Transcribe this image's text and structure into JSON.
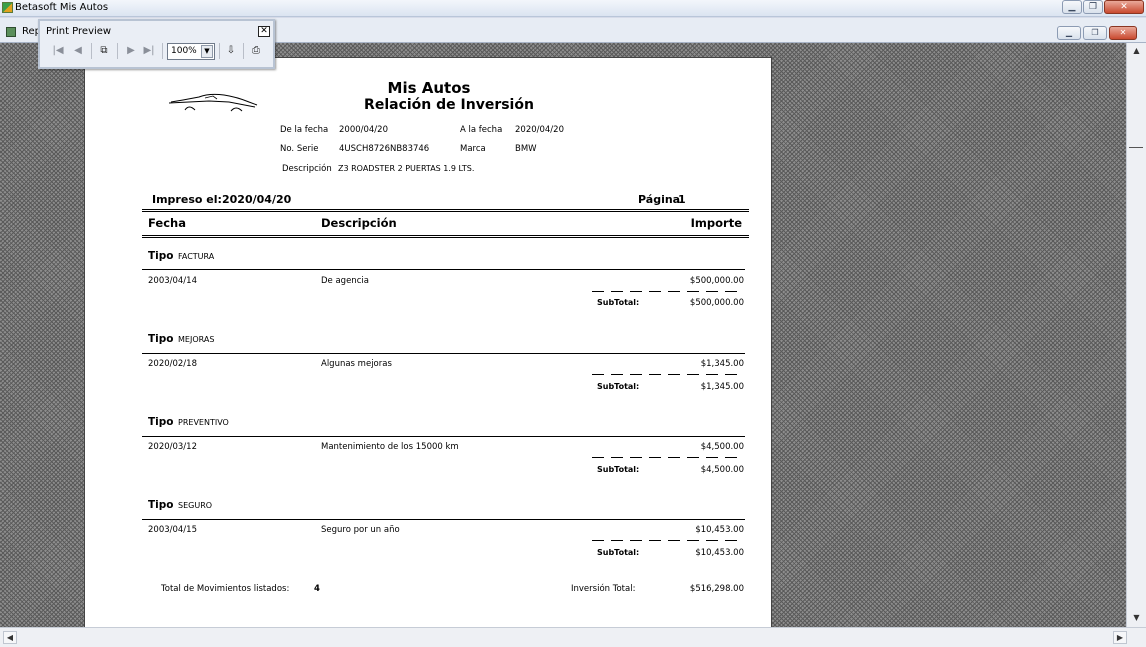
{
  "app": {
    "title": "Betasoft Mis Autos"
  },
  "child_window": {
    "title": "Rep"
  },
  "print_preview": {
    "title": "Print Preview",
    "close_glyph": "✕",
    "zoom": "100%",
    "icons": [
      "first-page-icon",
      "prev-page-icon",
      "copy-icon",
      "next-page-icon",
      "last-page-icon",
      "export-icon",
      "print-icon"
    ]
  },
  "report": {
    "title": "Mis Autos",
    "subtitle": "Relación de Inversión",
    "header": {
      "de_fecha_label": "De la fecha",
      "de_fecha": "2000/04/20",
      "a_fecha_label": "A la fecha",
      "a_fecha": "2020/04/20",
      "serie_label": "No. Serie",
      "serie": "4USCH8726NB83746",
      "marca_label": "Marca",
      "marca": "BMW",
      "descripcion_label": "Descripción",
      "descripcion": "Z3 ROADSTER 2 PUERTAS 1.9 LTS."
    },
    "impreso_label": "Impreso el:",
    "impreso": "2020/04/20",
    "pagina_label": "Página",
    "pagina": "1",
    "columns": {
      "fecha": "Fecha",
      "descripcion": "Descripción",
      "importe": "Importe"
    },
    "tipo_label": "Tipo",
    "subtotal_label": "SubTotal:",
    "groups": [
      {
        "tipo": "FACTURA",
        "fecha": "2003/04/14",
        "descripcion": "De agencia",
        "importe": "$500,000.00",
        "subtotal": "$500,000.00"
      },
      {
        "tipo": "MEJORAS",
        "fecha": "2020/02/18",
        "descripcion": "Algunas mejoras",
        "importe": "$1,345.00",
        "subtotal": "$1,345.00"
      },
      {
        "tipo": "PREVENTIVO",
        "fecha": "2020/03/12",
        "descripcion": "Mantenimiento de los 15000 km",
        "importe": "$4,500.00",
        "subtotal": "$4,500.00"
      },
      {
        "tipo": "SEGURO",
        "fecha": "2003/04/15",
        "descripcion": "Seguro por un año",
        "importe": "$10,453.00",
        "subtotal": "$10,453.00"
      }
    ],
    "total_movimientos_label": "Total de Movimientos listados:",
    "total_movimientos": "4",
    "inversion_total_label": "Inversión Total:",
    "inversion_total": "$516,298.00"
  },
  "colors": {
    "viewer_bg": "#8d8d8d",
    "page_bg": "#ffffff",
    "titlebar": "#dbe4f1",
    "close_red": "#c9492f"
  }
}
